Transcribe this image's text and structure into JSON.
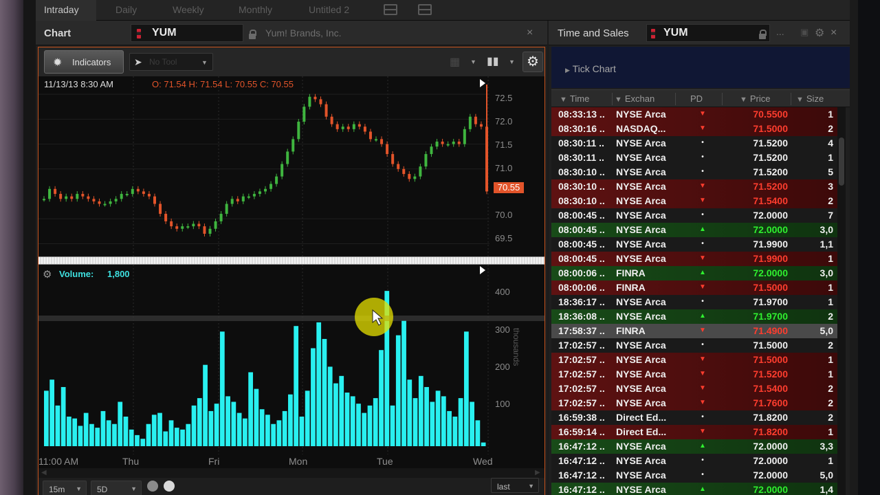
{
  "top_tabs": [
    {
      "label": "Intraday",
      "active": true
    },
    {
      "label": "Daily",
      "active": false
    },
    {
      "label": "Weekly",
      "active": false
    },
    {
      "label": "Monthly",
      "active": false
    },
    {
      "label": "Untitled 2",
      "active": false
    }
  ],
  "chart_panel": {
    "title": "Chart",
    "symbol": "YUM",
    "company": "Yum! Brands, Inc.",
    "close": "×",
    "indicators_label": "Indicators",
    "drawing_tool_placeholder": "No Tool",
    "ohlc_date": "11/13/13 8:30 AM",
    "ohlc_values": "O: 71.54 H: 71.54 L: 70.55 C: 70.55",
    "price_axis": [
      "72.5",
      "72.0",
      "71.5",
      "71.0",
      "70.0",
      "69.5"
    ],
    "last_price": "70.55",
    "volume_label": "Volume:",
    "volume_value": "1,800",
    "volume_axis": [
      "400",
      "300",
      "200",
      "100"
    ],
    "volume_unit": "thousands",
    "x_axis_labels": [
      "11:00 AM",
      "Thu",
      "Fri",
      "Mon",
      "Tue",
      "Wed"
    ],
    "interval": "15m",
    "period": "5D",
    "price_type": "last",
    "accent_color": "#c8531d",
    "volume_color": "#29f0f0",
    "up_color": "#3fb53f",
    "down_color": "#e2542a"
  },
  "ts_panel": {
    "title": "Time and Sales",
    "symbol": "YUM",
    "more": "...",
    "close": "×",
    "tick_chart_label": "Tick Chart",
    "columns": [
      "Time",
      "Exchan",
      "PD",
      "Price",
      "Size"
    ],
    "rows": [
      {
        "time": "08:33:13 ..",
        "exch": "NYSE Arca",
        "pd": "down",
        "price": "70.5500",
        "size": "1",
        "row": "red",
        "price_color": "red"
      },
      {
        "time": "08:30:16 ..",
        "exch": "NASDAQ...",
        "pd": "down",
        "price": "71.5000",
        "size": "2",
        "row": "red",
        "price_color": "red"
      },
      {
        "time": "08:30:11 ..",
        "exch": "NYSE Arca",
        "pd": "dot",
        "price": "71.5200",
        "size": "4",
        "row": "dark",
        "price_color": "white"
      },
      {
        "time": "08:30:11 ..",
        "exch": "NYSE Arca",
        "pd": "dot",
        "price": "71.5200",
        "size": "1",
        "row": "dark",
        "price_color": "white"
      },
      {
        "time": "08:30:10 ..",
        "exch": "NYSE Arca",
        "pd": "dot",
        "price": "71.5200",
        "size": "5",
        "row": "dark",
        "price_color": "white"
      },
      {
        "time": "08:30:10 ..",
        "exch": "NYSE Arca",
        "pd": "down",
        "price": "71.5200",
        "size": "3",
        "row": "red",
        "price_color": "red"
      },
      {
        "time": "08:30:10 ..",
        "exch": "NYSE Arca",
        "pd": "down",
        "price": "71.5400",
        "size": "2",
        "row": "red",
        "price_color": "red"
      },
      {
        "time": "08:00:45 ..",
        "exch": "NYSE Arca",
        "pd": "dot",
        "price": "72.0000",
        "size": "7",
        "row": "dark",
        "price_color": "white"
      },
      {
        "time": "08:00:45 ..",
        "exch": "NYSE Arca",
        "pd": "up",
        "price": "72.0000",
        "size": "3,0",
        "row": "green",
        "price_color": "green"
      },
      {
        "time": "08:00:45 ..",
        "exch": "NYSE Arca",
        "pd": "dot",
        "price": "71.9900",
        "size": "1,1",
        "row": "dark",
        "price_color": "white"
      },
      {
        "time": "08:00:45 ..",
        "exch": "NYSE Arca",
        "pd": "down",
        "price": "71.9900",
        "size": "1",
        "row": "red",
        "price_color": "red"
      },
      {
        "time": "08:00:06 ..",
        "exch": "FINRA",
        "pd": "up",
        "price": "72.0000",
        "size": "3,0",
        "row": "green",
        "price_color": "green"
      },
      {
        "time": "08:00:06 ..",
        "exch": "FINRA",
        "pd": "down",
        "price": "71.5000",
        "size": "1",
        "row": "red",
        "price_color": "red"
      },
      {
        "time": "18:36:17 ..",
        "exch": "NYSE Arca",
        "pd": "dot",
        "price": "71.9700",
        "size": "1",
        "row": "dark",
        "price_color": "white"
      },
      {
        "time": "18:36:08 ..",
        "exch": "NYSE Arca",
        "pd": "up",
        "price": "71.9700",
        "size": "2",
        "row": "green",
        "price_color": "green"
      },
      {
        "time": "17:58:37 ..",
        "exch": "FINRA",
        "pd": "down",
        "price": "71.4900",
        "size": "5,0",
        "row": "gray",
        "price_color": "red"
      },
      {
        "time": "17:02:57 ..",
        "exch": "NYSE Arca",
        "pd": "dot",
        "price": "71.5000",
        "size": "2",
        "row": "dark",
        "price_color": "white"
      },
      {
        "time": "17:02:57 ..",
        "exch": "NYSE Arca",
        "pd": "down",
        "price": "71.5000",
        "size": "1",
        "row": "red",
        "price_color": "red"
      },
      {
        "time": "17:02:57 ..",
        "exch": "NYSE Arca",
        "pd": "down",
        "price": "71.5200",
        "size": "1",
        "row": "red",
        "price_color": "red"
      },
      {
        "time": "17:02:57 ..",
        "exch": "NYSE Arca",
        "pd": "down",
        "price": "71.5400",
        "size": "2",
        "row": "red",
        "price_color": "red"
      },
      {
        "time": "17:02:57 ..",
        "exch": "NYSE Arca",
        "pd": "down",
        "price": "71.7600",
        "size": "2",
        "row": "red",
        "price_color": "red"
      },
      {
        "time": "16:59:38 ..",
        "exch": "Direct Ed...",
        "pd": "dot",
        "price": "71.8200",
        "size": "2",
        "row": "dark",
        "price_color": "white"
      },
      {
        "time": "16:59:14 ..",
        "exch": "Direct Ed...",
        "pd": "down",
        "price": "71.8200",
        "size": "1",
        "row": "red",
        "price_color": "red"
      },
      {
        "time": "16:47:12 ..",
        "exch": "NYSE Arca",
        "pd": "up",
        "price": "72.0000",
        "size": "3,3",
        "row": "green",
        "price_color": "white"
      },
      {
        "time": "16:47:12 ..",
        "exch": "NYSE Arca",
        "pd": "dot",
        "price": "72.0000",
        "size": "1",
        "row": "dark",
        "price_color": "white"
      },
      {
        "time": "16:47:12 ..",
        "exch": "NYSE Arca",
        "pd": "dot",
        "price": "72.0000",
        "size": "5,0",
        "row": "dark",
        "price_color": "white"
      },
      {
        "time": "16:47:12 ..",
        "exch": "NYSE Arca",
        "pd": "up",
        "price": "72.0000",
        "size": "1,4",
        "row": "green",
        "price_color": "green"
      }
    ]
  },
  "chart_data": {
    "type": "candlestick",
    "symbol": "YUM",
    "interval": "15m",
    "period": "5D",
    "x_labels": [
      "11:00 AM",
      "Thu",
      "Fri",
      "Mon",
      "Tue",
      "Wed"
    ],
    "price_ylim": [
      69.3,
      72.75
    ],
    "price_axis": [
      72.5,
      72.0,
      71.5,
      71.0,
      70.0,
      69.5
    ],
    "close_trace": [
      70.4,
      70.6,
      70.5,
      70.4,
      70.45,
      70.4,
      70.5,
      70.45,
      70.4,
      70.35,
      70.3,
      70.3,
      70.35,
      70.4,
      70.5,
      70.5,
      70.6,
      70.55,
      70.5,
      70.45,
      70.3,
      70.1,
      69.95,
      69.85,
      69.8,
      69.85,
      69.85,
      69.9,
      69.85,
      69.7,
      69.8,
      69.95,
      70.1,
      70.3,
      70.4,
      70.35,
      70.45,
      70.45,
      70.5,
      70.55,
      70.6,
      70.7,
      70.85,
      71.1,
      71.35,
      71.6,
      71.95,
      72.25,
      72.45,
      72.4,
      72.3,
      72.05,
      71.9,
      71.8,
      71.85,
      71.8,
      71.9,
      71.85,
      71.75,
      71.6,
      71.6,
      71.5,
      71.3,
      71.1,
      71.0,
      70.9,
      70.8,
      70.85,
      71.05,
      71.3,
      71.45,
      71.55,
      71.5,
      71.5,
      71.55,
      71.5,
      71.8,
      72.05,
      71.9,
      71.85,
      70.55
    ],
    "last_price": 70.55,
    "volume_ylim": [
      0,
      450
    ],
    "volume_axis": [
      400,
      300,
      200,
      100
    ],
    "volume_unit": "thousands",
    "volume_trace": [
      150,
      180,
      110,
      160,
      80,
      75,
      55,
      90,
      60,
      50,
      95,
      70,
      60,
      120,
      80,
      45,
      30,
      20,
      60,
      85,
      90,
      40,
      70,
      50,
      45,
      60,
      110,
      130,
      220,
      95,
      115,
      310,
      135,
      120,
      90,
      75,
      200,
      155,
      100,
      85,
      60,
      70,
      95,
      140,
      325,
      80,
      150,
      265,
      335,
      290,
      215,
      170,
      190,
      145,
      135,
      115,
      90,
      110,
      130,
      260,
      420,
      110,
      300,
      340,
      180,
      130,
      190,
      160,
      120,
      150,
      135,
      95,
      80,
      130,
      310,
      120,
      70,
      10
    ]
  }
}
